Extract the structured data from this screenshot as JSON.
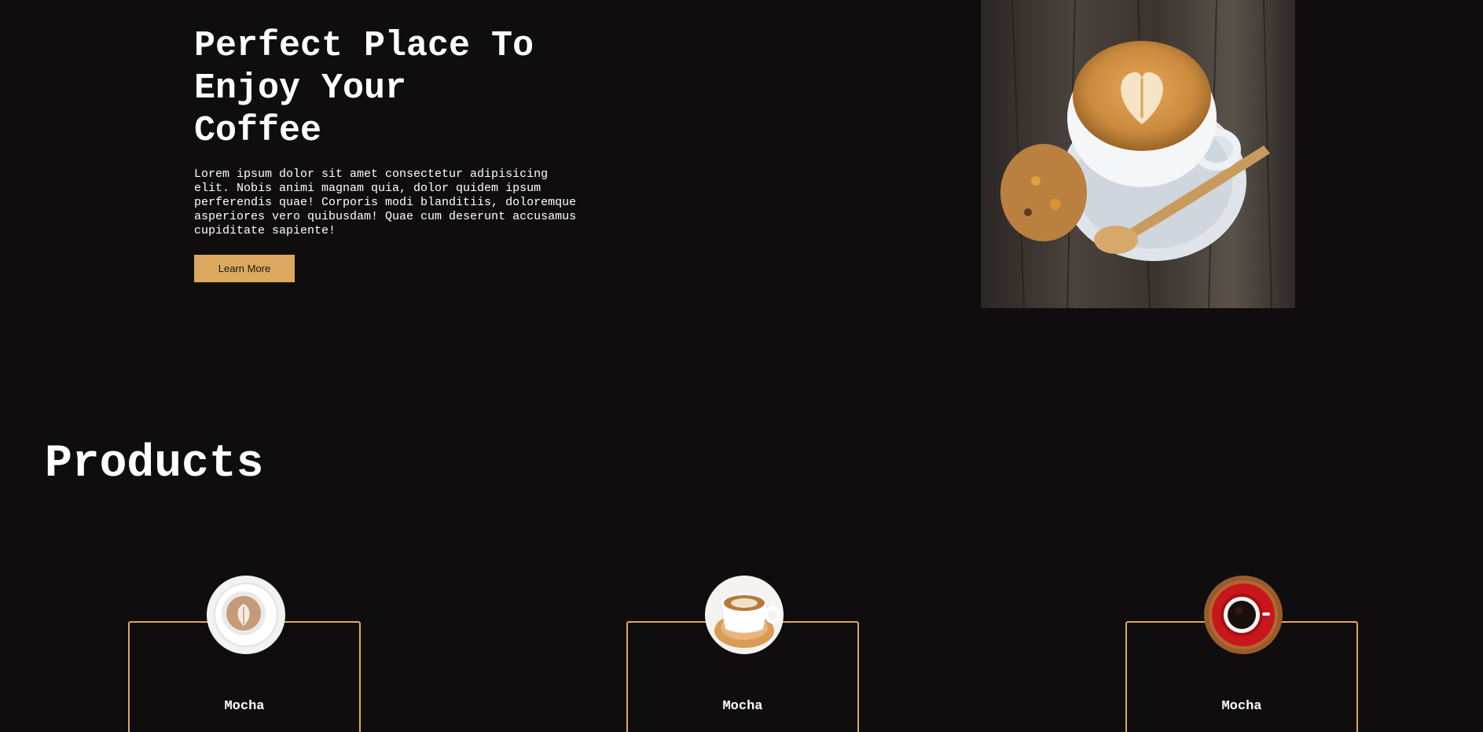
{
  "hero": {
    "title": "Perfect Place To Enjoy Your Coffee",
    "description": "Lorem ipsum dolor sit amet consectetur adipisicing elit. Nobis animi magnam quia, dolor quidem ipsum perferendis quae! Corporis modi blanditiis, doloremque asperiores vero quibusdam! Quae cum deserunt accusamus cupiditate sapiente!",
    "button_label": "Learn More",
    "image_icon": "latte-art-coffee-cup-photo"
  },
  "products": {
    "heading": "Products",
    "items": [
      {
        "name": "Mocha",
        "image_icon": "latte-cup-topview-photo"
      },
      {
        "name": "Mocha",
        "image_icon": "cappuccino-cup-photo"
      },
      {
        "name": "Mocha",
        "image_icon": "red-cup-black-coffee-photo"
      }
    ]
  },
  "colors": {
    "background": "#100d0e",
    "accent": "#dca85f",
    "text": "#ffffff"
  }
}
